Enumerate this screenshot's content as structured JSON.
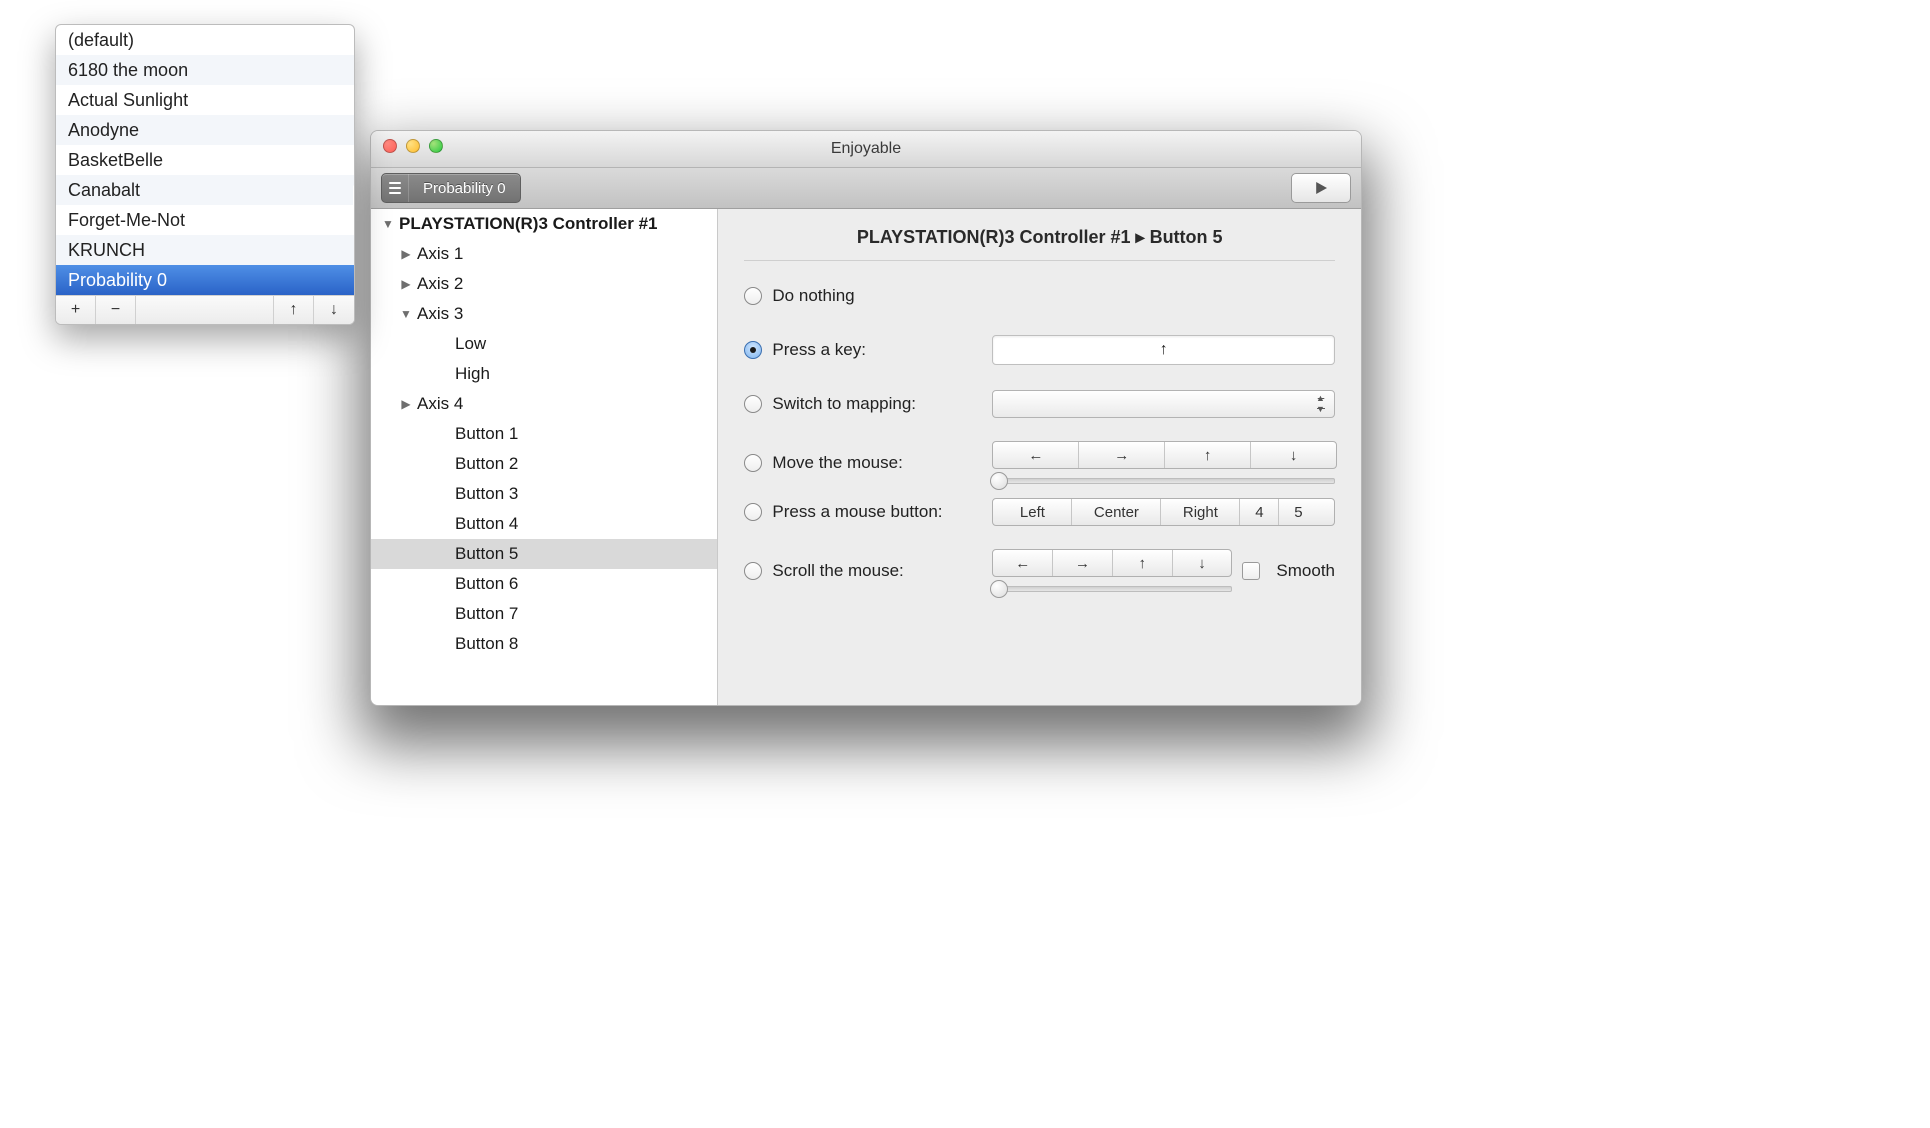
{
  "window": {
    "title": "Enjoyable"
  },
  "toolbar": {
    "mapping_label": "Probability 0"
  },
  "tree": {
    "controller": "PLAYSTATION(R)3 Controller #1",
    "items": [
      {
        "label": "Axis 1",
        "level": 1,
        "disclosure": "right"
      },
      {
        "label": "Axis 2",
        "level": 1,
        "disclosure": "right"
      },
      {
        "label": "Axis 3",
        "level": 1,
        "disclosure": "down"
      },
      {
        "label": "Low",
        "level": 2,
        "disclosure": "none"
      },
      {
        "label": "High",
        "level": 2,
        "disclosure": "none"
      },
      {
        "label": "Axis 4",
        "level": 1,
        "disclosure": "right"
      },
      {
        "label": "Button 1",
        "level": 2,
        "disclosure": "none"
      },
      {
        "label": "Button 2",
        "level": 2,
        "disclosure": "none"
      },
      {
        "label": "Button 3",
        "level": 2,
        "disclosure": "none"
      },
      {
        "label": "Button 4",
        "level": 2,
        "disclosure": "none"
      },
      {
        "label": "Button 5",
        "level": 2,
        "disclosure": "none",
        "selected": true
      },
      {
        "label": "Button 6",
        "level": 2,
        "disclosure": "none"
      },
      {
        "label": "Button 7",
        "level": 2,
        "disclosure": "none"
      },
      {
        "label": "Button 8",
        "level": 2,
        "disclosure": "none"
      }
    ]
  },
  "panel": {
    "breadcrumb": "PLAYSTATION(R)3 Controller #1 ▸ Button 5",
    "options": {
      "do_nothing": "Do nothing",
      "press_key": "Press a key:",
      "switch_mapping": "Switch to mapping:",
      "move_mouse": "Move the mouse:",
      "press_mouse": "Press a mouse button:",
      "scroll_mouse": "Scroll the mouse:"
    },
    "key_value": "↑",
    "move_dirs": [
      "←",
      "→",
      "↑",
      "↓"
    ],
    "mouse_buttons": [
      "Left",
      "Center",
      "Right",
      "4",
      "5"
    ],
    "scroll_dirs": [
      "←",
      "→",
      "↑",
      "↓"
    ],
    "smooth_label": "Smooth"
  },
  "popover": {
    "items": [
      "(default)",
      "6180 the moon",
      "Actual Sunlight",
      "Anodyne",
      "BasketBelle",
      "Canabalt",
      "Forget-Me-Not",
      "KRUNCH",
      "Probability 0"
    ],
    "selected_index": 8,
    "buttons": {
      "add": "+",
      "remove": "−",
      "up": "↑",
      "down": "↓"
    }
  }
}
